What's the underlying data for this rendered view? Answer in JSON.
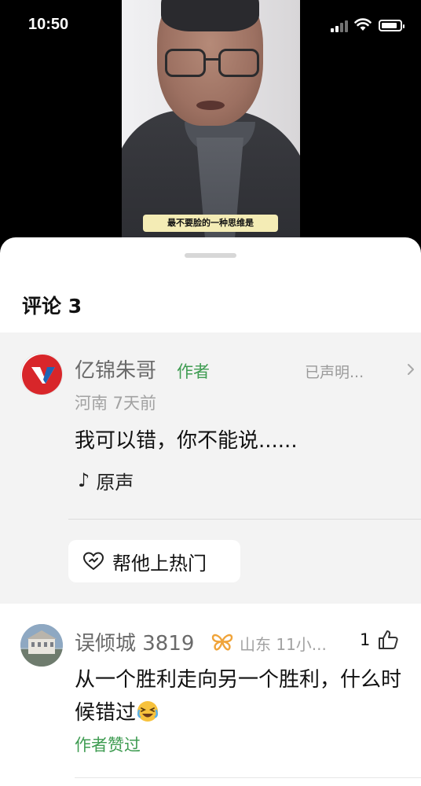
{
  "status_bar": {
    "time": "10:50"
  },
  "video": {
    "caption": "最不要脸的一种思维是"
  },
  "sheet": {
    "title": "评论 3"
  },
  "author_comment": {
    "name": "亿锦朱哥",
    "author_tag": "作者",
    "declared": "已声明...",
    "meta": "河南 7天前",
    "text": "我可以错，你不能说......",
    "music_label": "原声",
    "boost_label": "帮他上热门"
  },
  "comment2": {
    "name": "误倾城 3819",
    "region": "山东 11小...",
    "like_count": "1",
    "text": "从一个胜利走向另一个胜利，什么时候错过",
    "liked_by": "作者赞过"
  },
  "colors": {
    "green": "#3f9c52",
    "logo_red": "#d8262a",
    "logo_blue": "#1f64b5",
    "badge_orange": "#f0a43a"
  },
  "icons": [
    "signal-icon",
    "wifi-icon",
    "battery-icon",
    "chevron-right-icon",
    "music-note-icon",
    "heart-boost-icon",
    "butterfly-badge-icon",
    "thumbs-up-icon",
    "laughing-emoji-icon"
  ]
}
